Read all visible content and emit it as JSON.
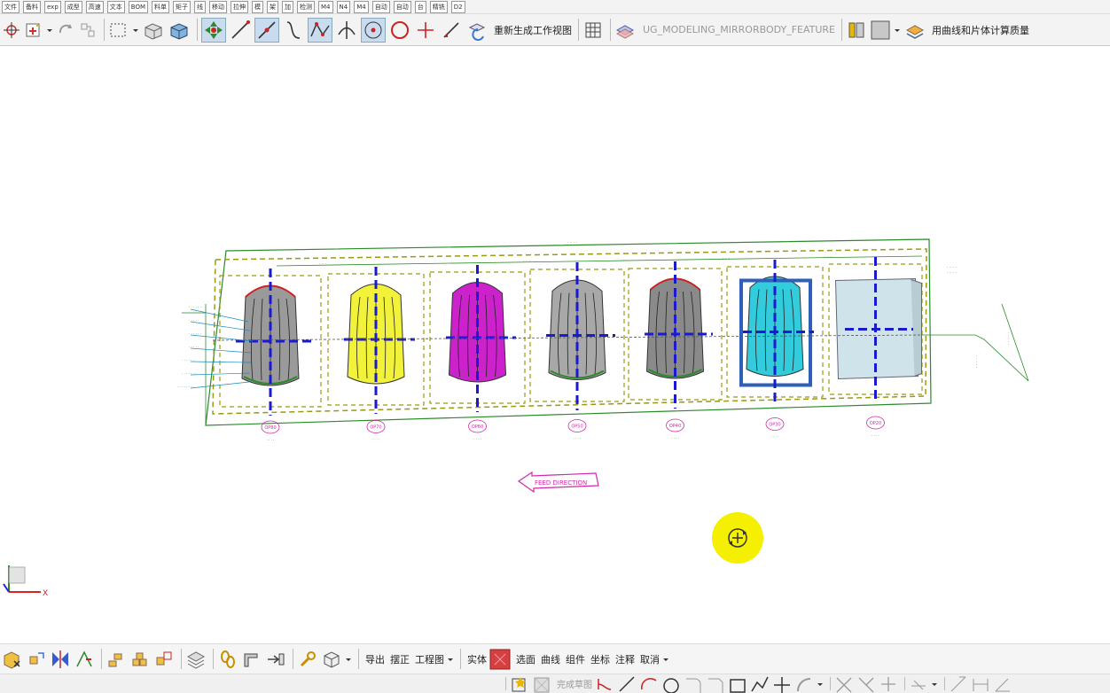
{
  "toolbar_top": {
    "items": [
      "文件",
      "备料",
      "exp",
      "成型",
      "高速",
      "文本",
      "BOM",
      "料单",
      "矩子",
      "线",
      "移动",
      "拉伸",
      "模",
      "架",
      "加",
      "检测",
      "M4",
      "N4",
      "M4",
      "自动",
      "自动",
      "台",
      "精铣",
      "D2"
    ]
  },
  "toolbar_main": {
    "regen_view_label": "重新生成工作视图",
    "feature_name": "UG_MODELING_MIRRORBODY_FEATURE",
    "mass_label": "用曲线和片体计算质量"
  },
  "toolbar_bottom": {
    "export": "导出",
    "straighten": "摆正",
    "drawing": "工程图",
    "solid": "实体",
    "select_face": "选面",
    "curve": "曲线",
    "component": "组件",
    "coord": "坐标",
    "annotation": "注释",
    "cancel": "取消"
  },
  "sketch_bar": {
    "finish_sketch": "完成草图"
  },
  "drawing": {
    "feed_direction": "FEED DIRECTION",
    "stations": [
      {
        "label": "OP80",
        "color": "#9a9a9a"
      },
      {
        "label": "OP70",
        "color": "#f2f23a"
      },
      {
        "label": "OP60",
        "color": "#cc22cc"
      },
      {
        "label": "OP50",
        "color": "#a8a8a8"
      },
      {
        "label": "OP40",
        "color": "#8a8a8a"
      },
      {
        "label": "OP30",
        "color": "#33ccdd"
      },
      {
        "label": "OP20",
        "color": "#cfe3ea"
      }
    ]
  },
  "view_triad": {
    "x_label": "X"
  },
  "colors": {
    "dim_green": "#2a8a2a",
    "centerline_blue": "#1a1ad0",
    "frame_olive": "#9a9a10",
    "highlight_yellow": "#f5f000"
  }
}
